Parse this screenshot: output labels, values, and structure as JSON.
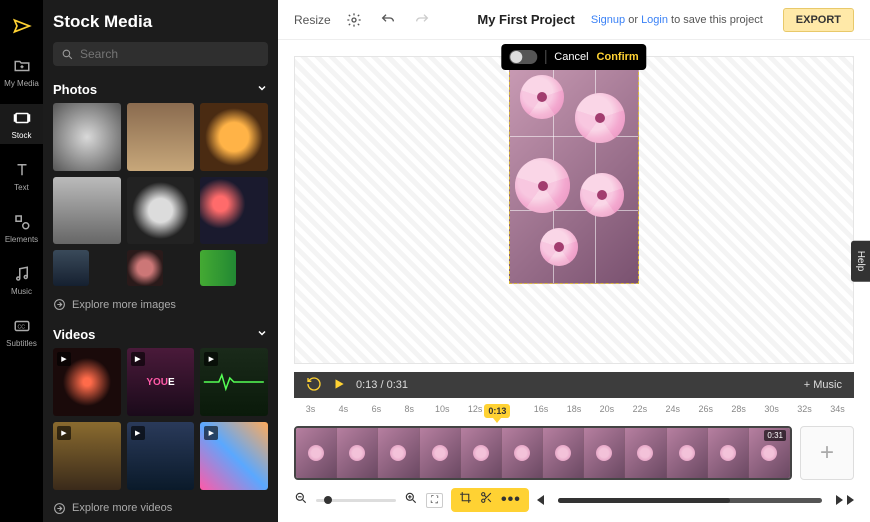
{
  "rail": {
    "items": [
      {
        "key": "logo",
        "label": ""
      },
      {
        "key": "mymedia",
        "label": "My Media"
      },
      {
        "key": "stock",
        "label": "Stock"
      },
      {
        "key": "text",
        "label": "Text"
      },
      {
        "key": "elements",
        "label": "Elements"
      },
      {
        "key": "music",
        "label": "Music"
      },
      {
        "key": "subtitles",
        "label": "Subtitles"
      }
    ]
  },
  "side": {
    "title": "Stock Media",
    "search_placeholder": "Search",
    "photos_header": "Photos",
    "videos_header": "Videos",
    "explore_images": "Explore more images",
    "explore_videos": "Explore more videos"
  },
  "topbar": {
    "resize": "Resize",
    "project_title": "My First Project",
    "save_prefix": "",
    "signup": "Signup",
    "or": " or ",
    "login": "Login",
    "save_suffix": " to save this project",
    "export": "EXPORT"
  },
  "cropbar": {
    "cancel": "Cancel",
    "confirm": "Confirm"
  },
  "playbar": {
    "current": "0:13",
    "sep": " / ",
    "total": "0:31",
    "add_music": "+ Music"
  },
  "ruler": {
    "ticks": [
      "3s",
      "4s",
      "6s",
      "8s",
      "10s",
      "12s",
      "0:13",
      "16s",
      "18s",
      "20s",
      "22s",
      "24s",
      "26s",
      "28s",
      "30s",
      "32s",
      "34s"
    ],
    "playhead": "0:13"
  },
  "track": {
    "duration_badge": "0:31"
  },
  "help": "Help"
}
